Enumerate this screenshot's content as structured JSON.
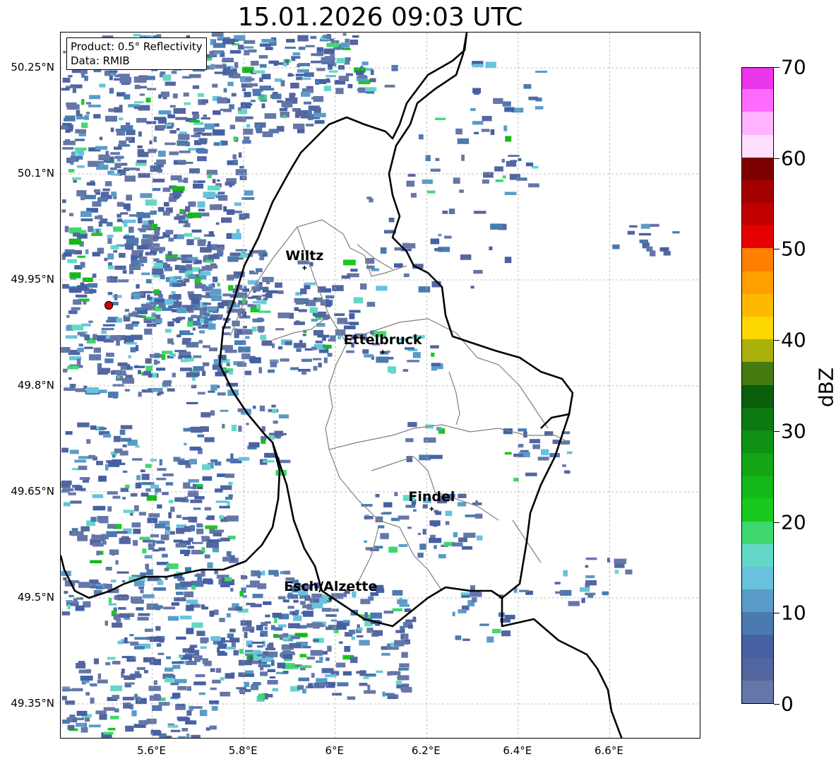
{
  "title": "15.01.2026 09:03 UTC",
  "info": {
    "product": "Product: 0.5° Reflectivity",
    "data": "Data: RMIB"
  },
  "map": {
    "lon_range": [
      5.4,
      6.8
    ],
    "lat_range": [
      49.3,
      50.3
    ],
    "lat_ticks": [
      {
        "value": 50.25,
        "label": "50.25°N"
      },
      {
        "value": 50.1,
        "label": "50.1°N"
      },
      {
        "value": 49.95,
        "label": "49.95°N"
      },
      {
        "value": 49.8,
        "label": "49.8°N"
      },
      {
        "value": 49.65,
        "label": "49.65°N"
      },
      {
        "value": 49.5,
        "label": "49.5°N"
      },
      {
        "value": 49.35,
        "label": "49.35°N"
      }
    ],
    "lon_ticks": [
      {
        "value": 5.6,
        "label": "5.6°E"
      },
      {
        "value": 5.8,
        "label": "5.8°E"
      },
      {
        "value": 6.0,
        "label": "6°E"
      },
      {
        "value": 6.2,
        "label": "6.2°E"
      },
      {
        "value": 6.4,
        "label": "6.4°E"
      },
      {
        "value": 6.6,
        "label": "6.6°E"
      }
    ],
    "radar_site": {
      "lon": 5.505,
      "lat": 49.914,
      "color": "#e00000"
    },
    "cities": [
      {
        "name": "Wiltz",
        "lon": 5.933,
        "lat": 49.967
      },
      {
        "name": "Ettelbruck",
        "lon": 6.104,
        "lat": 49.848
      },
      {
        "name": "Findel",
        "lon": 6.211,
        "lat": 49.626
      },
      {
        "name": "Esch/Alzette",
        "lon": 5.99,
        "lat": 49.499
      }
    ],
    "border_color": "#000000",
    "canton_color": "#808080",
    "grid_color": "#b0b0b0"
  },
  "colorbar": {
    "unit": "dBZ",
    "min": 0,
    "max": 70,
    "step": 2.5,
    "ticks": [
      0,
      10,
      20,
      30,
      40,
      50,
      60,
      70
    ],
    "colors": [
      "#6577a8",
      "#5466a0",
      "#4560a3",
      "#4a7ab0",
      "#5a9cc8",
      "#68c2df",
      "#63d8c7",
      "#3fd86f",
      "#19c81d",
      "#14b818",
      "#12a515",
      "#0f9214",
      "#0c7a10",
      "#0a5e0c",
      "#467a10",
      "#aab00a",
      "#ffd700",
      "#ffb800",
      "#ffa000",
      "#ff8000",
      "#e40000",
      "#c20000",
      "#a30000",
      "#7d0000",
      "#ffe0ff",
      "#ffb3ff",
      "#ff6bff",
      "#ea35ea"
    ]
  }
}
